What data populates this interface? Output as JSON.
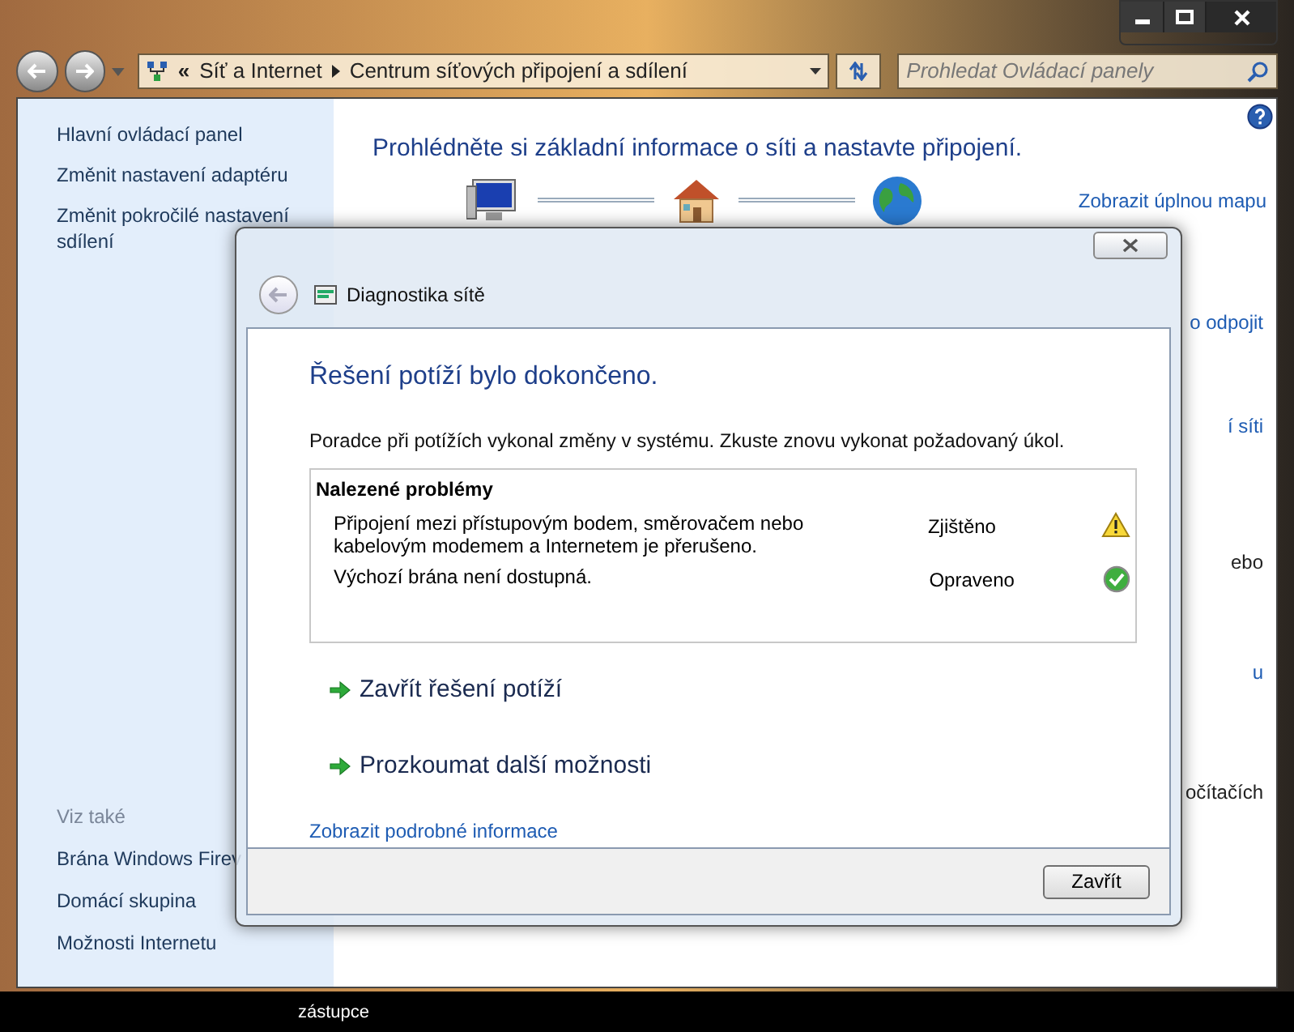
{
  "address_bar": {
    "overflow": "«",
    "segments": [
      "Síť a Internet",
      "Centrum síťových připojení a sdílení"
    ]
  },
  "search": {
    "placeholder": "Prohledat Ovládací panely"
  },
  "sidebar": {
    "items": [
      "Hlavní ovládací panel",
      "Změnit nastavení adaptéru",
      "Změnit pokročilé nastavení sdílení"
    ],
    "see_also_title": "Viz také",
    "see_also": [
      "Brána Windows Firev",
      "Domácí skupina",
      "Možnosti Internetu"
    ]
  },
  "main": {
    "heading": "Prohlédněte si základní informace o síti a nastavte připojení.",
    "map_link": "Zobrazit úplnou mapu",
    "fragments": [
      "o odpojit",
      "í síti",
      "ebo",
      "u",
      "očítačích"
    ]
  },
  "dialog": {
    "title": "Diagnostika sítě",
    "heading": "Řešení potíží bylo dokončeno.",
    "message": "Poradce při potížích vykonal změny v systému. Zkuste znovu vykonat požadovaný úkol.",
    "problems_title": "Nalezené problémy",
    "problems": [
      {
        "text": "Připojení mezi přístupovým bodem, směrovačem nebo kabelovým modemem a Internetem je přerušeno.",
        "status": "Zjištěno",
        "kind": "warning"
      },
      {
        "text": "Výchozí brána není dostupná.",
        "status": "Opraveno",
        "kind": "fixed"
      }
    ],
    "actions": [
      "Zavřít řešení potíží",
      "Prozkoumat další možnosti"
    ],
    "details_link": "Zobrazit podrobné informace",
    "close_button": "Zavřít"
  },
  "desktop_label": "zástupce"
}
